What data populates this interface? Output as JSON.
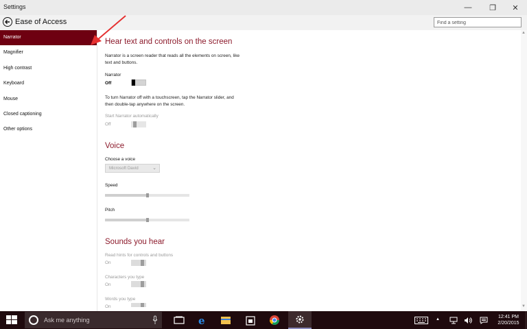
{
  "window": {
    "title": "Settings",
    "minimize_glyph": "—",
    "maximize_glyph": "❐",
    "close_glyph": "✕"
  },
  "header": {
    "title": "Ease of Access",
    "search_placeholder": "Find a setting"
  },
  "sidebar": {
    "items": [
      {
        "label": "Narrator",
        "active": true
      },
      {
        "label": "Magnifier"
      },
      {
        "label": "High contrast"
      },
      {
        "label": "Keyboard"
      },
      {
        "label": "Mouse"
      },
      {
        "label": "Closed captioning"
      },
      {
        "label": "Other options"
      }
    ]
  },
  "content": {
    "section1": {
      "heading": "Hear text and controls on the screen",
      "description": "Narrator is a screen reader that reads all the elements on screen, like text and buttons.",
      "narrator_label": "Narrator",
      "narrator_state": "Off",
      "touch_hint": "To turn Narrator off with a touchscreen, tap the Narrator slider, and then double-tap anywhere on the screen.",
      "auto_start_label": "Start Narrator automatically",
      "auto_start_state": "Off"
    },
    "voice": {
      "heading": "Voice",
      "choose_label": "Choose a voice",
      "selected_voice": "Microsoft David",
      "speed_label": "Speed",
      "speed_value": 0.5,
      "pitch_label": "Pitch",
      "pitch_value": 0.5
    },
    "sounds": {
      "heading": "Sounds you hear",
      "hints_label": "Read hints for controls and buttons",
      "hints_state": "On",
      "chars_label": "Characters you type",
      "chars_state": "On",
      "words_label": "Words you type",
      "words_state": "On"
    }
  },
  "taskbar": {
    "search_placeholder": "Ask me anything",
    "clock_time": "12:41 PM",
    "clock_date": "2/20/2015",
    "tray_up": "▲"
  },
  "colors": {
    "accent": "#6e0011",
    "heading": "#8c1a2b",
    "taskbar": "#1f0a0e"
  }
}
